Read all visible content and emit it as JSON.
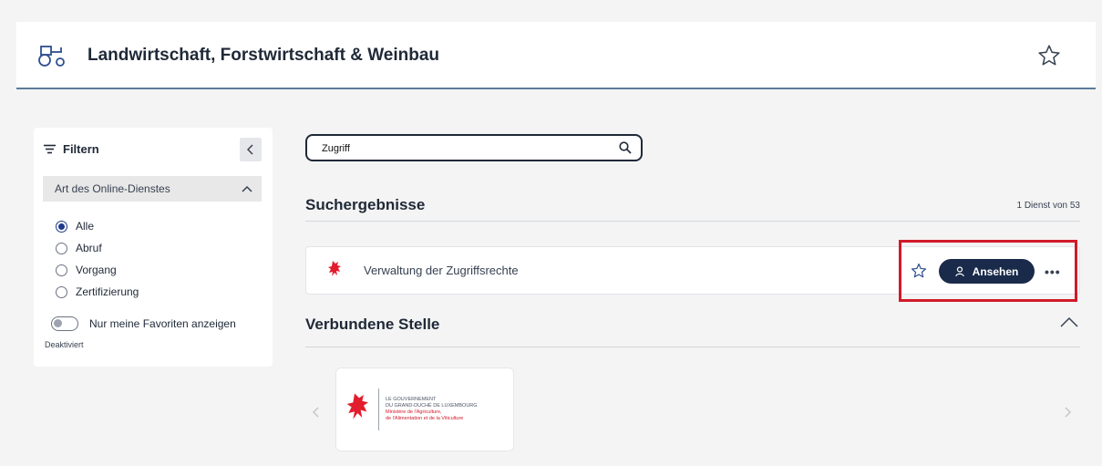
{
  "header": {
    "title": "Landwirtschaft, Forstwirtschaft & Weinbau"
  },
  "sidebar": {
    "filter_label": "Filtern",
    "section_label": "Art des Online-Dienstes",
    "options": [
      {
        "label": "Alle",
        "selected": true
      },
      {
        "label": "Abruf",
        "selected": false
      },
      {
        "label": "Vorgang",
        "selected": false
      },
      {
        "label": "Zertifizierung",
        "selected": false
      }
    ],
    "favorites_toggle_label": "Nur meine Favoriten anzeigen",
    "favorites_toggle_status": "Deaktiviert"
  },
  "search": {
    "value": "Zugriff"
  },
  "results": {
    "title": "Suchergebnisse",
    "count": "1 Dienst von 53",
    "items": [
      {
        "name": "Verwaltung der Zugriffsrechte",
        "action_label": "Ansehen"
      }
    ]
  },
  "related": {
    "title": "Verbundene Stelle",
    "org_lines": [
      "LE GOUVERNEMENT",
      "DU GRAND-DUCHÉ DE LUXEMBOURG",
      "Ministère de l'Agriculture,",
      "de l'Alimentation et de la Viticulture"
    ]
  },
  "colors": {
    "accent_dark": "#1a2a4a",
    "highlight_red": "#d11a2a",
    "lion_red": "#e11d2e"
  }
}
